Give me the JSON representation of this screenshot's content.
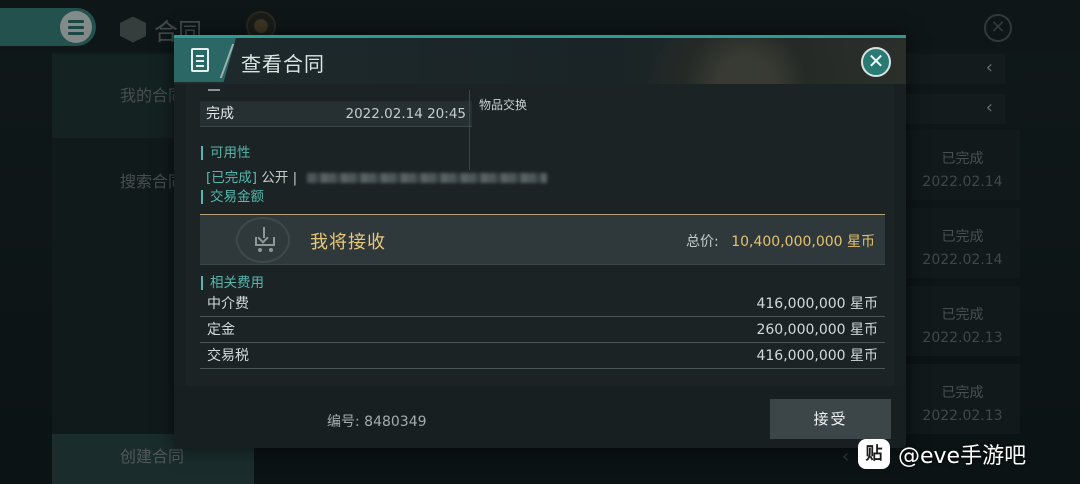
{
  "background": {
    "title": "合同",
    "sidebar": [
      {
        "label": "我的合同"
      },
      {
        "label": "搜索合同"
      }
    ],
    "create_label": "创建合同",
    "filter_chevron": "‹",
    "rows": [
      {
        "status": "已完成",
        "date": "2022.02.14"
      },
      {
        "status": "已完成",
        "date": "2022.02.14"
      },
      {
        "status": "已完成",
        "date": "2022.02.13"
      },
      {
        "status": "已完成",
        "date": "2022.02.13"
      }
    ]
  },
  "modal": {
    "title": "查看合同",
    "close_glyph": "✕",
    "status": "完成",
    "status_date": "2022.02.14 20:45",
    "item_exchange": "物品交换",
    "availability": {
      "label": "可用性",
      "done": "[已完成]",
      "public": "公开 |"
    },
    "trade": {
      "section_label": "交易金额",
      "label": "我将接收",
      "total_label": "总价:",
      "total_value": "10,400,000,000 星币"
    },
    "fees": {
      "section_label": "相关费用",
      "rows": [
        {
          "name": "中介费",
          "value": "416,000,000 星币"
        },
        {
          "name": "定金",
          "value": "260,000,000 星币"
        },
        {
          "name": "交易税",
          "value": "416,000,000 星币"
        }
      ]
    },
    "contract_number": "编号: 8480349",
    "accept_label": "接受"
  },
  "watermark": {
    "logo": "贴",
    "text": "@eve手游吧"
  },
  "colors": {
    "accent": "#2d9b95",
    "gold": "#e4c06f",
    "section": "#56b6ad"
  }
}
